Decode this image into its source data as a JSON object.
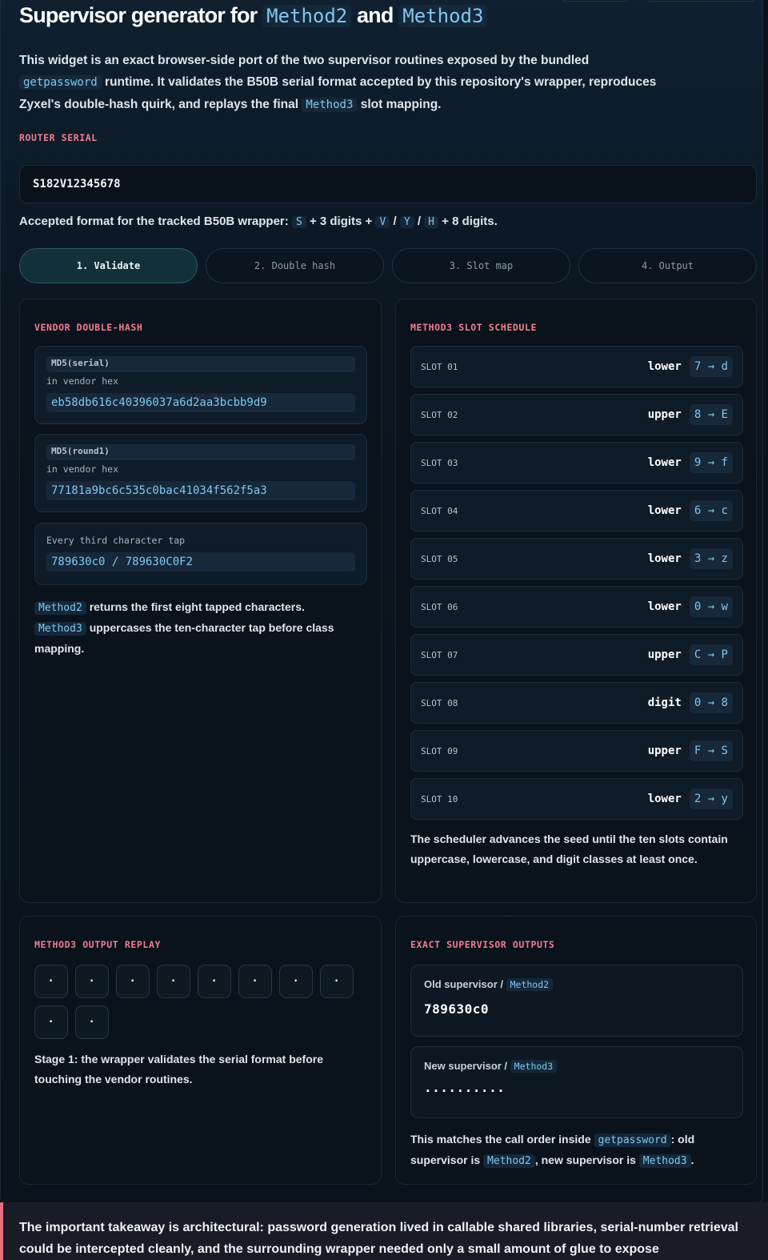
{
  "title": {
    "prefix": "Supervisor generator for",
    "method2": "Method2",
    "and": "and",
    "method3": "Method3"
  },
  "intro": {
    "p1": "This widget is an exact browser-side port of the two supervisor routines exposed by the bundled",
    "code1": "getpassword",
    "p2": "runtime. It validates the B50B serial format accepted by this repository's wrapper, reproduces Zyxel's double-hash quirk, and replays the final",
    "code2": "Method3",
    "p3": "slot mapping."
  },
  "serial": {
    "label": "ROUTER SERIAL",
    "value": "S182V12345678"
  },
  "format": {
    "prefix": "Accepted format for the tracked B50B wrapper:",
    "s": "S",
    "mid": "+ 3 digits +",
    "v": "V",
    "slash": "/",
    "y": "Y",
    "h": "H",
    "suffix": "+ 8 digits."
  },
  "steps": [
    {
      "label": "1. Validate",
      "active": true
    },
    {
      "label": "2. Double hash",
      "active": false
    },
    {
      "label": "3. Slot map",
      "active": false
    },
    {
      "label": "4. Output",
      "active": false
    }
  ],
  "hash_panel": {
    "title": "VENDOR DOUBLE-HASH",
    "round0": {
      "tag": "MD5(serial)",
      "sub": "in vendor hex",
      "value": "eb58db616c40396037a6d2aa3bcbb9d9"
    },
    "round1": {
      "tag": "MD5(round1)",
      "sub": "in vendor hex",
      "value": "77181a9bc6c535c0bac41034f562f5a3"
    },
    "tap": {
      "sub": "Every third character tap",
      "value": "789630c0 / 789630C0F2"
    },
    "note": {
      "code1": "Method2",
      "text1": "returns the first eight tapped characters.",
      "code2": "Method3",
      "text2": "uppercases the ten-character tap before class mapping."
    }
  },
  "slot_panel": {
    "title": "METHOD3 SLOT SCHEDULE",
    "slots": [
      {
        "name": "SLOT 01",
        "class": "lower",
        "map": "7 → d"
      },
      {
        "name": "SLOT 02",
        "class": "upper",
        "map": "8 → E"
      },
      {
        "name": "SLOT 03",
        "class": "lower",
        "map": "9 → f"
      },
      {
        "name": "SLOT 04",
        "class": "lower",
        "map": "6 → c"
      },
      {
        "name": "SLOT 05",
        "class": "lower",
        "map": "3 → z"
      },
      {
        "name": "SLOT 06",
        "class": "lower",
        "map": "0 → w"
      },
      {
        "name": "SLOT 07",
        "class": "upper",
        "map": "C → P"
      },
      {
        "name": "SLOT 08",
        "class": "digit",
        "map": "0 → 8"
      },
      {
        "name": "SLOT 09",
        "class": "upper",
        "map": "F → S"
      },
      {
        "name": "SLOT 10",
        "class": "lower",
        "map": "2 → y"
      }
    ],
    "note": "The scheduler advances the seed until the ten slots contain uppercase, lowercase, and digit classes at least once."
  },
  "replay_panel": {
    "title": "METHOD3 OUTPUT REPLAY",
    "cells": [
      "·",
      "·",
      "·",
      "·",
      "·",
      "·",
      "·",
      "·",
      "·",
      "·"
    ],
    "note": "Stage 1: the wrapper validates the serial format before touching the vendor routines."
  },
  "outputs_panel": {
    "title": "EXACT SUPERVISOR OUTPUTS",
    "old_label": "Old supervisor /",
    "old_code": "Method2",
    "old_value": "789630c0",
    "new_label": "New supervisor /",
    "new_code": "Method3",
    "new_value": "··········",
    "note": {
      "t1": "This matches the call order inside",
      "c1": "getpassword",
      "t2": ": old supervisor is",
      "c2": "Method2",
      "t3": ", new supervisor is",
      "c3": "Method3",
      "t4": "."
    }
  },
  "takeaway": "The important takeaway is architectural: password generation lived in callable shared libraries, serial-number retrieval could be intercepted cleanly, and the surrounding wrapper needed only a small amount of glue to expose"
}
